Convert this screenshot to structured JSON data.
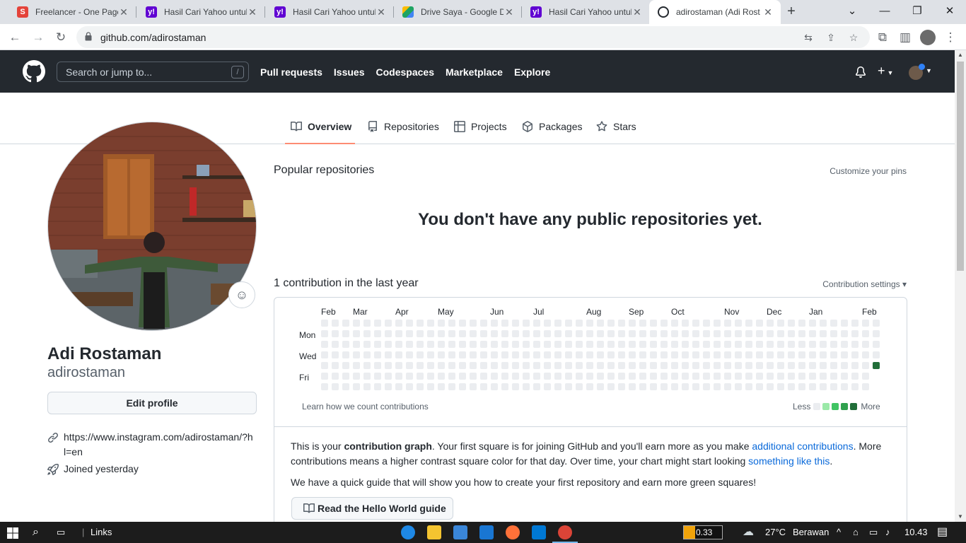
{
  "browser": {
    "tabs": [
      {
        "title": "Freelancer - One Page",
        "favicon": "S",
        "favicon_color": "#e4433a"
      },
      {
        "title": "Hasil Cari Yahoo untuk",
        "favicon": "y!",
        "favicon_color": "#6001d2"
      },
      {
        "title": "Hasil Cari Yahoo untuk",
        "favicon": "y!",
        "favicon_color": "#6001d2"
      },
      {
        "title": "Drive Saya - Google D",
        "favicon": "drive",
        "favicon_color": "#1fa463"
      },
      {
        "title": "Hasil Cari Yahoo untuk",
        "favicon": "y!",
        "favicon_color": "#6001d2"
      },
      {
        "title": "adirostaman (Adi Rost",
        "favicon": "github",
        "favicon_color": "#24292f"
      }
    ],
    "active_tab": 5,
    "url": "github.com/adirostaman"
  },
  "github": {
    "search_placeholder": "Search or jump to...",
    "search_shortcut": "/",
    "nav": [
      "Pull requests",
      "Issues",
      "Codespaces",
      "Marketplace",
      "Explore"
    ]
  },
  "profile_tabs": [
    {
      "label": "Overview",
      "icon": "book-icon",
      "selected": true
    },
    {
      "label": "Repositories",
      "icon": "repo-icon",
      "selected": false
    },
    {
      "label": "Projects",
      "icon": "table-icon",
      "selected": false
    },
    {
      "label": "Packages",
      "icon": "package-icon",
      "selected": false
    },
    {
      "label": "Stars",
      "icon": "star-icon",
      "selected": false
    }
  ],
  "profile": {
    "name": "Adi Rostaman",
    "login": "adirostaman",
    "edit_label": "Edit profile",
    "link": "https://www.instagram.com/adirostaman/?hl=en",
    "joined": "Joined yesterday"
  },
  "main": {
    "popular_heading": "Popular repositories",
    "customize": "Customize your pins",
    "empty_message": "You don't have any public repositories yet.",
    "contrib_heading": "1 contribution in the last year",
    "contrib_settings": "Contribution settings ▾",
    "months": [
      "Feb",
      "Mar",
      "Apr",
      "May",
      "Jun",
      "Jul",
      "Aug",
      "Sep",
      "Oct",
      "Nov",
      "Dec",
      "Jan",
      "Feb"
    ],
    "day_labels": [
      "Mon",
      "Wed",
      "Fri"
    ],
    "learn": "Learn how we count contributions",
    "legend_less": "Less",
    "legend_more": "More",
    "legend_colors": [
      "#ebedf0",
      "#9be9a8",
      "#40c463",
      "#30a14e",
      "#216e39"
    ],
    "contributions": {
      "weeks": 53,
      "active_week": 52,
      "active_day": 4,
      "active_color": "#216e39",
      "empty_color": "#ebedf0",
      "last_week_days": 5
    },
    "explain_1": "This is your ",
    "explain_bold": "contribution graph",
    "explain_2": ". Your first square is for joining GitHub and you'll earn more as you make ",
    "explain_link1": "additional contributions",
    "explain_3": ". More contributions means a higher contrast square color for that day. Over time, your chart might start looking ",
    "explain_link2": "something like this",
    "explain_4": ".",
    "quick_guide": "We have a quick guide that will show you how to create your first repository and earn more green squares!",
    "hello_button": "Read the Hello World guide"
  },
  "taskbar": {
    "links_label": "Links",
    "cpu": "0.33",
    "temperature": "27°C",
    "weather": "Berawan",
    "time": "10.43"
  }
}
